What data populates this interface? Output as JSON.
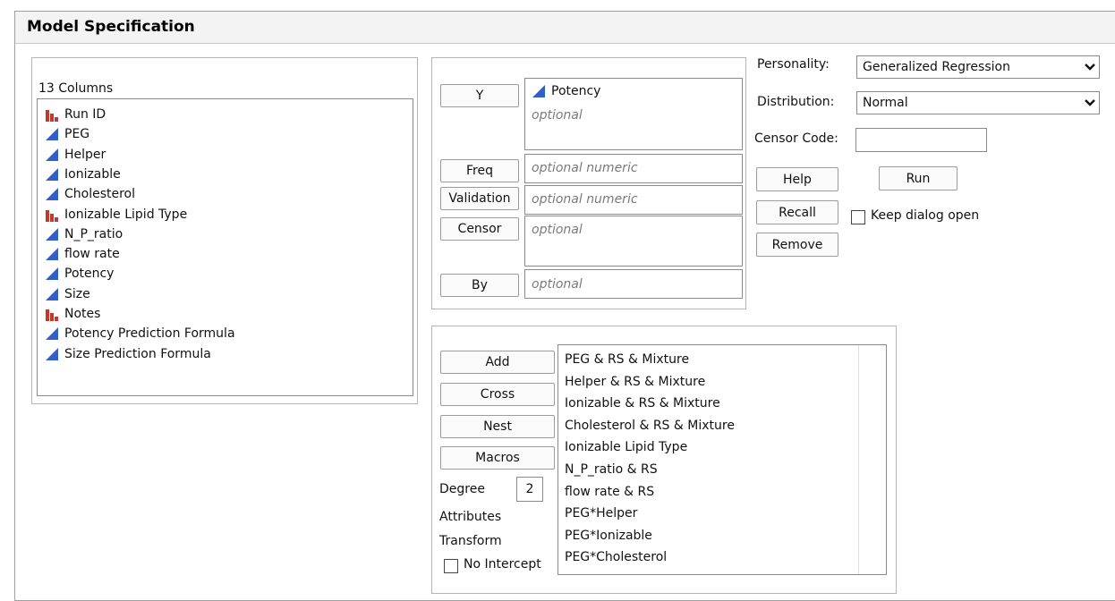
{
  "title": "Model Specification",
  "columns": {
    "header": "13 Columns",
    "items": [
      {
        "name": "Run ID",
        "type": "nominal"
      },
      {
        "name": "PEG",
        "type": "continuous"
      },
      {
        "name": "Helper",
        "type": "continuous"
      },
      {
        "name": "Ionizable",
        "type": "continuous"
      },
      {
        "name": "Cholesterol",
        "type": "continuous"
      },
      {
        "name": "Ionizable Lipid Type",
        "type": "nominal"
      },
      {
        "name": "N_P_ratio",
        "type": "continuous"
      },
      {
        "name": "flow rate",
        "type": "continuous"
      },
      {
        "name": "Potency",
        "type": "continuous"
      },
      {
        "name": "Size",
        "type": "continuous"
      },
      {
        "name": "Notes",
        "type": "nominal"
      },
      {
        "name": "Potency Prediction Formula",
        "type": "continuous"
      },
      {
        "name": "Size Prediction Formula",
        "type": "continuous"
      }
    ]
  },
  "roles": {
    "y_label": "Y",
    "y_value": "Potency",
    "y_placeholder": "optional",
    "freq_label": "Freq",
    "freq_placeholder": "optional numeric",
    "validation_label": "Validation",
    "validation_placeholder": "optional numeric",
    "censor_label": "Censor",
    "censor_placeholder": "optional",
    "by_label": "By",
    "by_placeholder": "optional"
  },
  "options": {
    "personality_label": "Personality:",
    "personality_value": "Generalized Regression",
    "distribution_label": "Distribution:",
    "distribution_value": "Normal",
    "censor_code_label": "Censor Code:",
    "help_label": "Help",
    "run_label": "Run",
    "recall_label": "Recall",
    "keep_open_label": "Keep dialog open",
    "remove_label": "Remove"
  },
  "effects": {
    "add_label": "Add",
    "cross_label": "Cross",
    "nest_label": "Nest",
    "macros_label": "Macros",
    "degree_label": "Degree",
    "degree_value": "2",
    "attributes_label": "Attributes",
    "transform_label": "Transform",
    "no_intercept_label": "No Intercept",
    "terms": [
      "PEG & RS & Mixture",
      "Helper & RS & Mixture",
      "Ionizable & RS & Mixture",
      "Cholesterol & RS & Mixture",
      "Ionizable Lipid Type",
      "N_P_ratio & RS",
      "flow rate & RS",
      "PEG*Helper",
      "PEG*Ionizable",
      "PEG*Cholesterol"
    ]
  },
  "colors": {
    "continuous_icon": "#2f5fc8",
    "nominal_icon": "#c0392b"
  },
  "icons": {
    "continuous": "continuous-blue-triangle-icon",
    "nominal": "nominal-red-bars-icon",
    "dropdown": "chevron-down-icon"
  }
}
